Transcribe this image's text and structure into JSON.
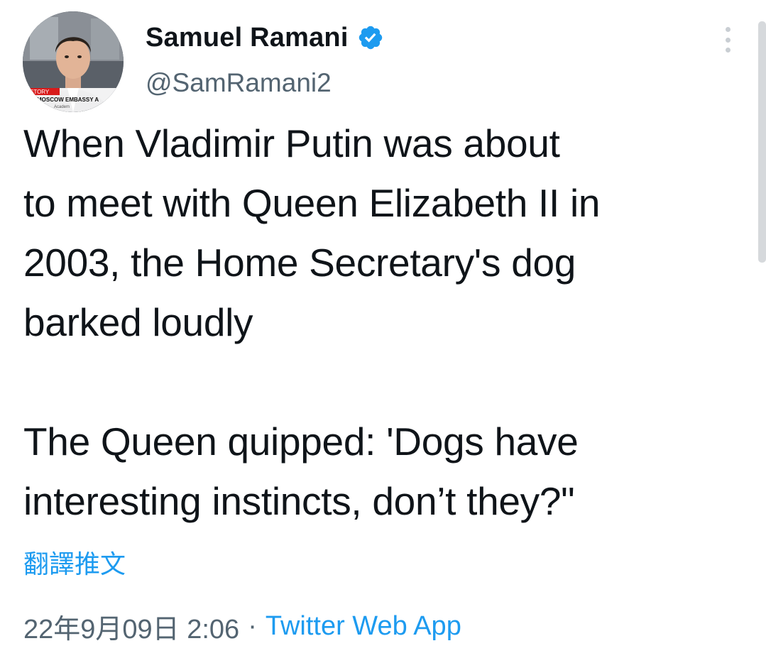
{
  "author": {
    "display_name": "Samuel Ramani",
    "handle": "@SamRamani2",
    "verified": true,
    "avatar_overlay_lines": [
      "STORY",
      "MOSCOW EMBASSY A",
      "Academ"
    ]
  },
  "tweet": {
    "text": "When Vladimir Putin was about\nto meet with Queen Elizabeth II in\n2003, the Home Secretary's dog\nbarked loudly\n\nThe Queen quipped: 'Dogs have\ninteresting instincts, don’t they?\"",
    "translate_label": "翻譯推文",
    "date_time": "22年9月09日 2:06",
    "separator": "·",
    "source": "Twitter Web App"
  },
  "icons": {
    "verified": "verified-badge-icon",
    "more": "more-options-icon"
  },
  "colors": {
    "accent": "#1d9bf0",
    "text": "#0f1419",
    "secondary": "#536471"
  }
}
